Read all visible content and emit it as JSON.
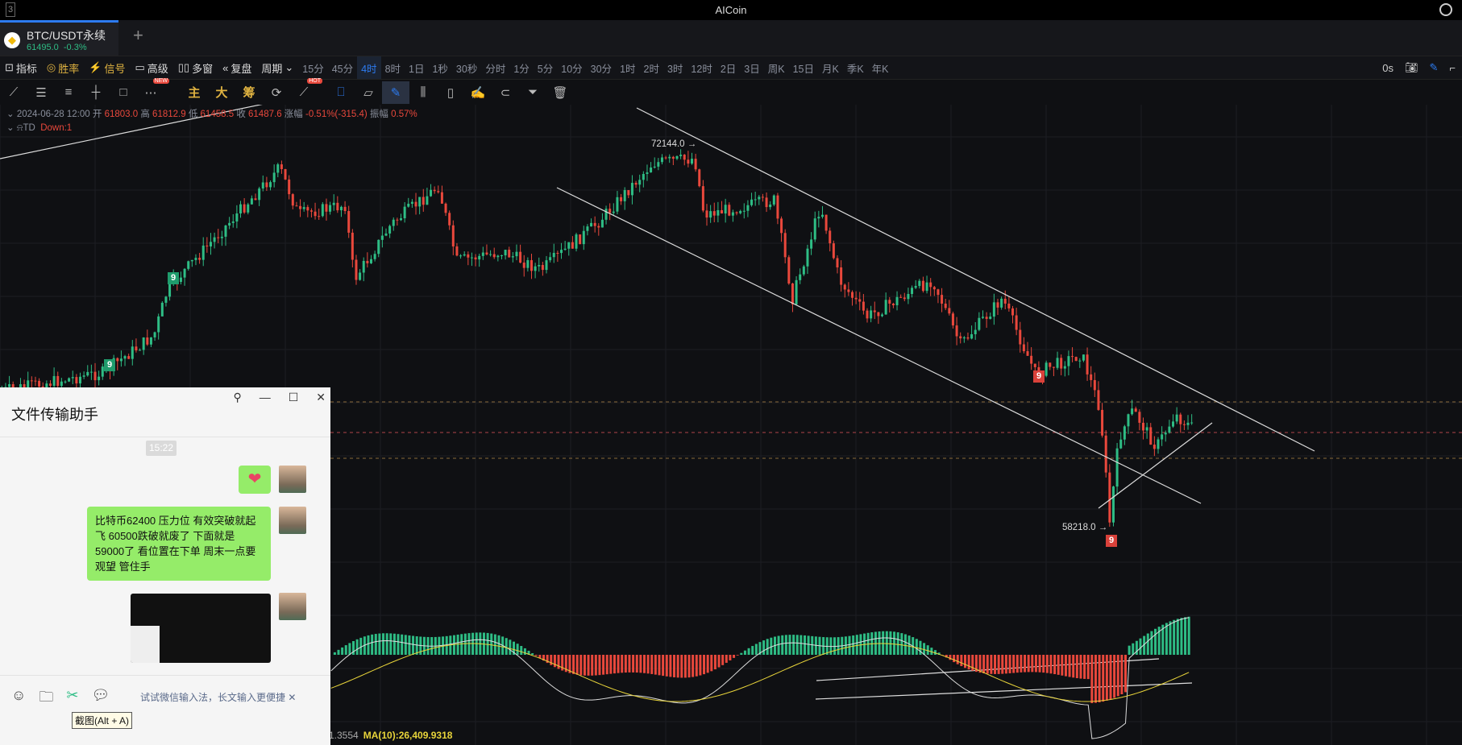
{
  "window": {
    "title": "AICoin",
    "number": "3"
  },
  "tab": {
    "symbol": "BTC/USDT永续",
    "price": "61495.0",
    "change": "-0.3%"
  },
  "toolbar": {
    "buttons": [
      "指标",
      "胜率",
      "信号",
      "高级",
      "多窗",
      "复盘",
      "周期"
    ],
    "periods": [
      "15分",
      "45分",
      "4时",
      "8时",
      "1日",
      "1秒",
      "30秒",
      "分时",
      "1分",
      "5分",
      "10分",
      "30分",
      "1时",
      "2时",
      "3时",
      "12时",
      "2日",
      "3日",
      "周K",
      "15日",
      "月K",
      "季K",
      "年K"
    ],
    "active_period": "4时",
    "countdown": "0s"
  },
  "drawing_tools": {
    "new_badge": "NEW",
    "hot_badge": "HOT",
    "main": "主",
    "big": "大",
    "chip": "筹"
  },
  "ohlc": {
    "datetime": "2024-06-28 12:00",
    "open_label": "开",
    "open": "61803.0",
    "high_label": "高",
    "high": "61812.9",
    "low_label": "低",
    "low": "61458.5",
    "close_label": "收",
    "close": "61487.6",
    "change_label": "涨幅",
    "change": "-0.51%(-315.4)",
    "amp_label": "振幅",
    "amp": "0.57%"
  },
  "td": {
    "label": "TD",
    "value": "Down:1"
  },
  "annotations": {
    "high": "72144.0 →",
    "low": "58218.0 →",
    "nine": "9"
  },
  "macd": {
    "prev": "1.3554",
    "ma": "MA(10):26,409.9318"
  },
  "colors": {
    "up": "#2ebd85",
    "down": "#e9483c",
    "accent": "#2d7bf0"
  },
  "chat": {
    "title": "文件传输助手",
    "time": "15:22",
    "heart": "❤",
    "message": "比特币62400 压力位  有效突破就起飞  60500跌破就废了  下面就是59000了  看位置在下单  周末一点要观望  管住手",
    "hint": "试试微信输入法，长文输入更便捷",
    "tooltip": "截图(Alt + A)"
  }
}
